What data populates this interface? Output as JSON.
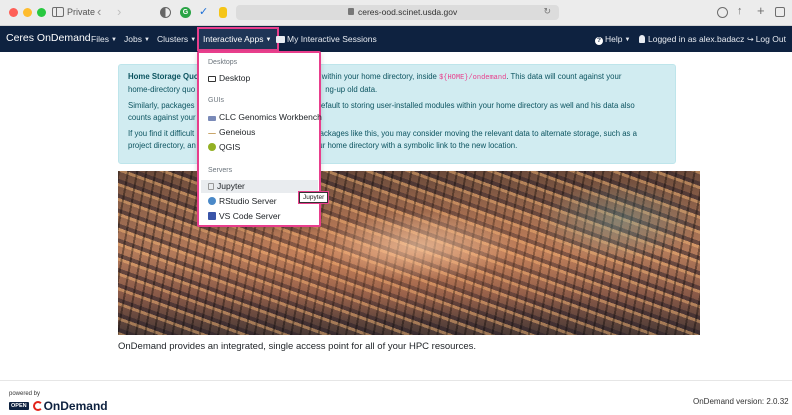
{
  "browser": {
    "private_label": "Private",
    "url": "ceres-ood.scinet.usda.gov"
  },
  "navbar": {
    "brand": "Ceres OnDemand",
    "files": "Files",
    "jobs": "Jobs",
    "clusters": "Clusters",
    "interactive_apps": "Interactive Apps",
    "sessions": "My Interactive Sessions",
    "help": "Help",
    "user": "Logged in as alex.badacz",
    "logout": "Log Out"
  },
  "alert": {
    "title": "Home Storage Quota",
    "p1_a": "and job logs within your home directory, inside",
    "p1_code": "${HOME}/ondemand",
    "p1_b": ". This data will count against your",
    "p1_c": "home-directory quo",
    "p1_d": "ng-up old data.",
    "p2_a": "Similarly, packages",
    "p2_b": "s default to storing user-installed modules within your home directory as well and his data also",
    "p2_c": "counts against your",
    "p3_a": "If you find it difficult",
    "p3_b": "and packages like this, you may consider moving the relevant data to alternate storage, such as a",
    "p3_c": "project directory, an",
    "p3_d": "in your home directory with a symbolic link to the new location."
  },
  "dropdown": {
    "header_desktops": "Desktops",
    "desktop": "Desktop",
    "header_guis": "GUIs",
    "clc": "CLC Genomics Workbench",
    "geneious": "Geneious",
    "qgis": "QGIS",
    "header_servers": "Servers",
    "jupyter": "Jupyter",
    "rstudio": "RStudio Server",
    "vscode": "VS Code Server"
  },
  "tooltip": "Jupyter",
  "caption": "OnDemand provides an integrated, single access point for all of your HPC resources.",
  "footer": {
    "powered_by": "powered by",
    "logo_open": "OPEN",
    "logo_text": "OnDemand",
    "version": "OnDemand version: 2.0.32"
  },
  "colors": {
    "navbar_bg": "#0e2240",
    "highlight": "#e83e8c",
    "alert_bg": "#d1ecf1",
    "alert_text": "#0c5460"
  }
}
